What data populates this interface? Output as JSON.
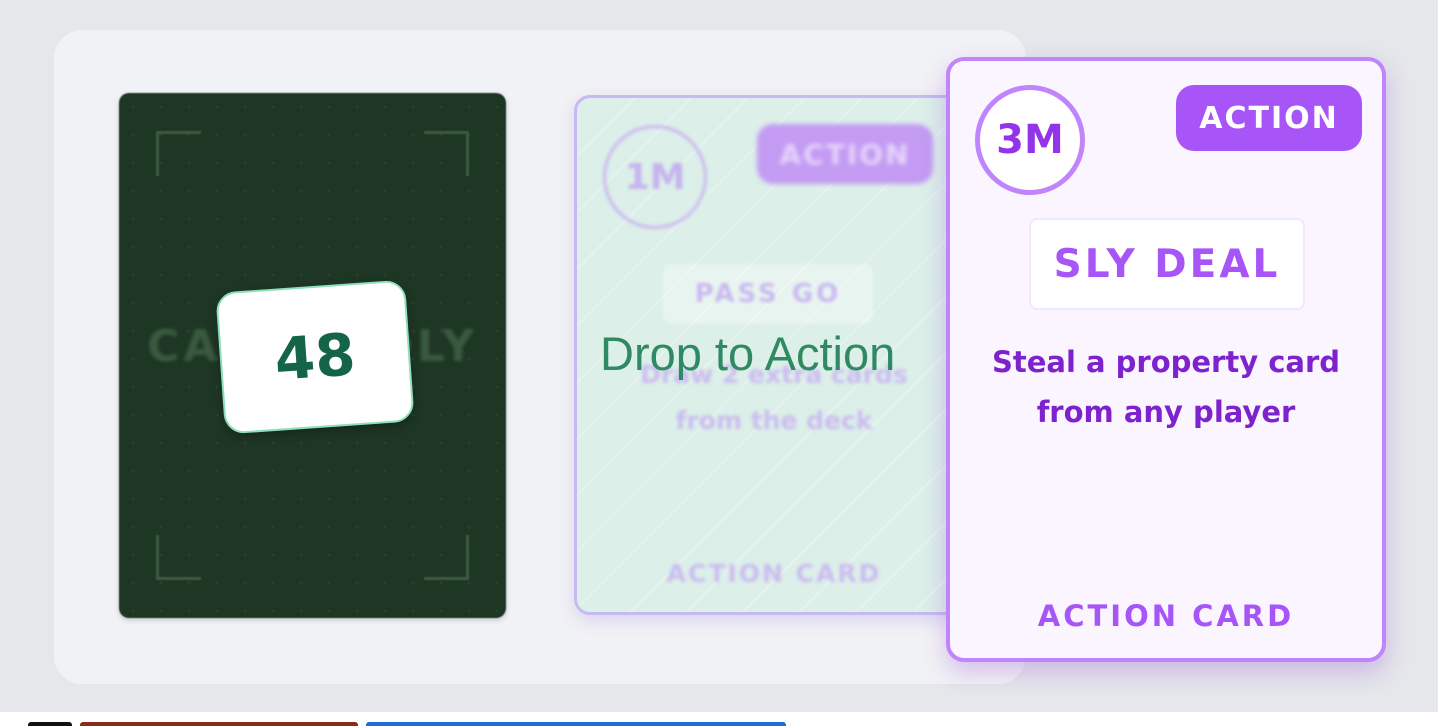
{
  "deck": {
    "brand": "CASHOPOLY",
    "count": "48"
  },
  "drop_target": {
    "hint": "Drop to Action",
    "preview_card": {
      "value": "1M",
      "type_badge": "ACTION",
      "name": "PASS GO",
      "description_lines": [
        "Draw 2 extra cards",
        "from the deck"
      ],
      "footer": "ACTION CARD"
    }
  },
  "dragged_card": {
    "value": "3M",
    "type_badge": "ACTION",
    "name": "SLY DEAL",
    "description_lines": [
      "Steal a property card",
      "from any player"
    ],
    "footer": "ACTION CARD"
  },
  "colors": {
    "deck_bg": "#1e3624",
    "deck_count_text": "#146447",
    "drop_hint": "#2f8a63",
    "action_purple": "#a855f7",
    "action_text_dark": "#7e22ce",
    "ghost_bg": "#dcefe9"
  }
}
